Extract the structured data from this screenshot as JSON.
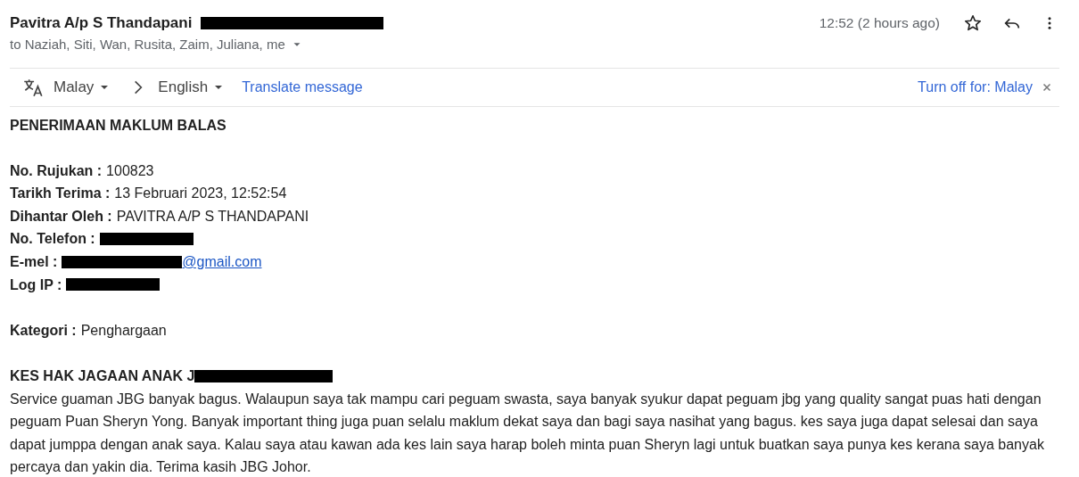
{
  "header": {
    "sender": "Pavitra A/p S Thandapani",
    "sender_redacted": true,
    "recipients": "to Naziah, Siti, Wan, Rusita, Zaim, Juliana, me",
    "time": "12:52 (2 hours ago)",
    "starred": false
  },
  "translate_bar": {
    "source_language": "Malay",
    "target_language": "English",
    "translate_link": "Translate message",
    "turn_off_link": "Turn off for: Malay"
  },
  "body": {
    "title": "PENERIMAAN MAKLUM BALAS",
    "fields": [
      {
        "label": "No. Rujukan :",
        "value": "100823",
        "kind": "text",
        "redacted": false
      },
      {
        "label": "Tarikh Terima :",
        "value": "13 Februari 2023, 12:52:54",
        "kind": "text",
        "redacted": false
      },
      {
        "label": "Dihantar Oleh :",
        "value": "PAVITRA A/P S THANDAPANI",
        "kind": "text",
        "redacted": false
      },
      {
        "label": "No. Telefon :",
        "kind": "text",
        "redacted": true
      },
      {
        "label": "E-mel :",
        "value": "@gmail.com",
        "kind": "link",
        "redacted": true
      },
      {
        "label": "Log IP :",
        "kind": "text",
        "redacted": true
      }
    ],
    "category": {
      "label": "Kategori :",
      "value": "Penghargaan"
    },
    "subject": {
      "text": "KES HAK JAGAAN ANAK J",
      "redacted": true
    },
    "message": "Service guaman JBG banyak bagus. Walaupun saya tak mampu cari peguam swasta, saya banyak syukur dapat peguam jbg yang quality sangat puas hati dengan peguam Puan Sheryn Yong. Banyak important thing juga puan selalu maklum dekat saya dan bagi saya nasihat yang bagus. kes saya juga dapat selesai dan saya dapat jumppa dengan anak saya. Kalau saya atau kawan ada kes lain saya harap boleh minta puan Sheryn lagi untuk buatkan saya punya kes kerana saya banyak percaya dan yakin dia. Terima kasih JBG Johor."
  }
}
